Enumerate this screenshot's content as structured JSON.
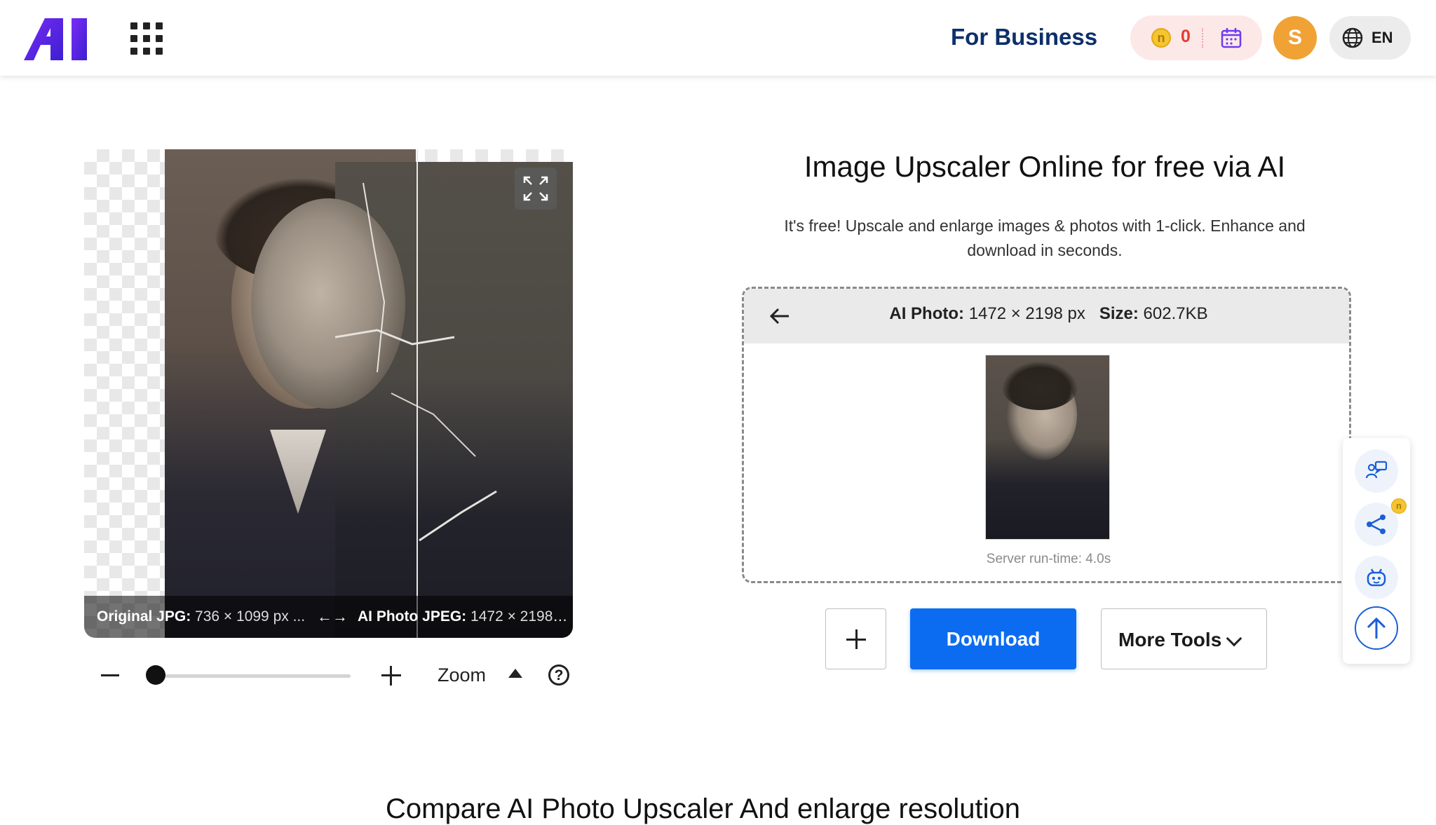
{
  "header": {
    "logo_text": "AI",
    "for_business": "For Business",
    "coin_count": "0",
    "avatar_initial": "S",
    "language": "EN"
  },
  "viewer": {
    "original_label": "Original JPG:",
    "original_dims": "736 × 1099 px ...",
    "ai_label": "AI Photo JPEG:",
    "ai_dims": "1472 × 2198 ...",
    "compare_arrow": "<-->"
  },
  "zoom": {
    "label": "Zoom",
    "help": "?",
    "level": 0
  },
  "main": {
    "title": "Image Upscaler Online for free via AI",
    "subtitle": "It's free! Upscale and enlarge images & photos with 1-click. Enhance and download in seconds."
  },
  "result": {
    "photo_label": "AI Photo:",
    "photo_dims": "1472 × 2198 px",
    "size_label": "Size:",
    "size_value": "602.7KB",
    "runtime": "Server run-time: 4.0s"
  },
  "actions": {
    "download": "Download",
    "more_tools": "More Tools"
  },
  "floating": {
    "badge_coin": "n",
    "icons": [
      "feedback-icon",
      "share-icon",
      "bot-icon",
      "arrow-up-icon"
    ]
  },
  "colors": {
    "primary": "#0b6cf1",
    "brand_dark": "#0d2f6b",
    "avatar": "#f0a235",
    "coin_count": "#e63b2e"
  },
  "footer_partial": "Compare AI Photo Upscaler And enlarge resolution"
}
